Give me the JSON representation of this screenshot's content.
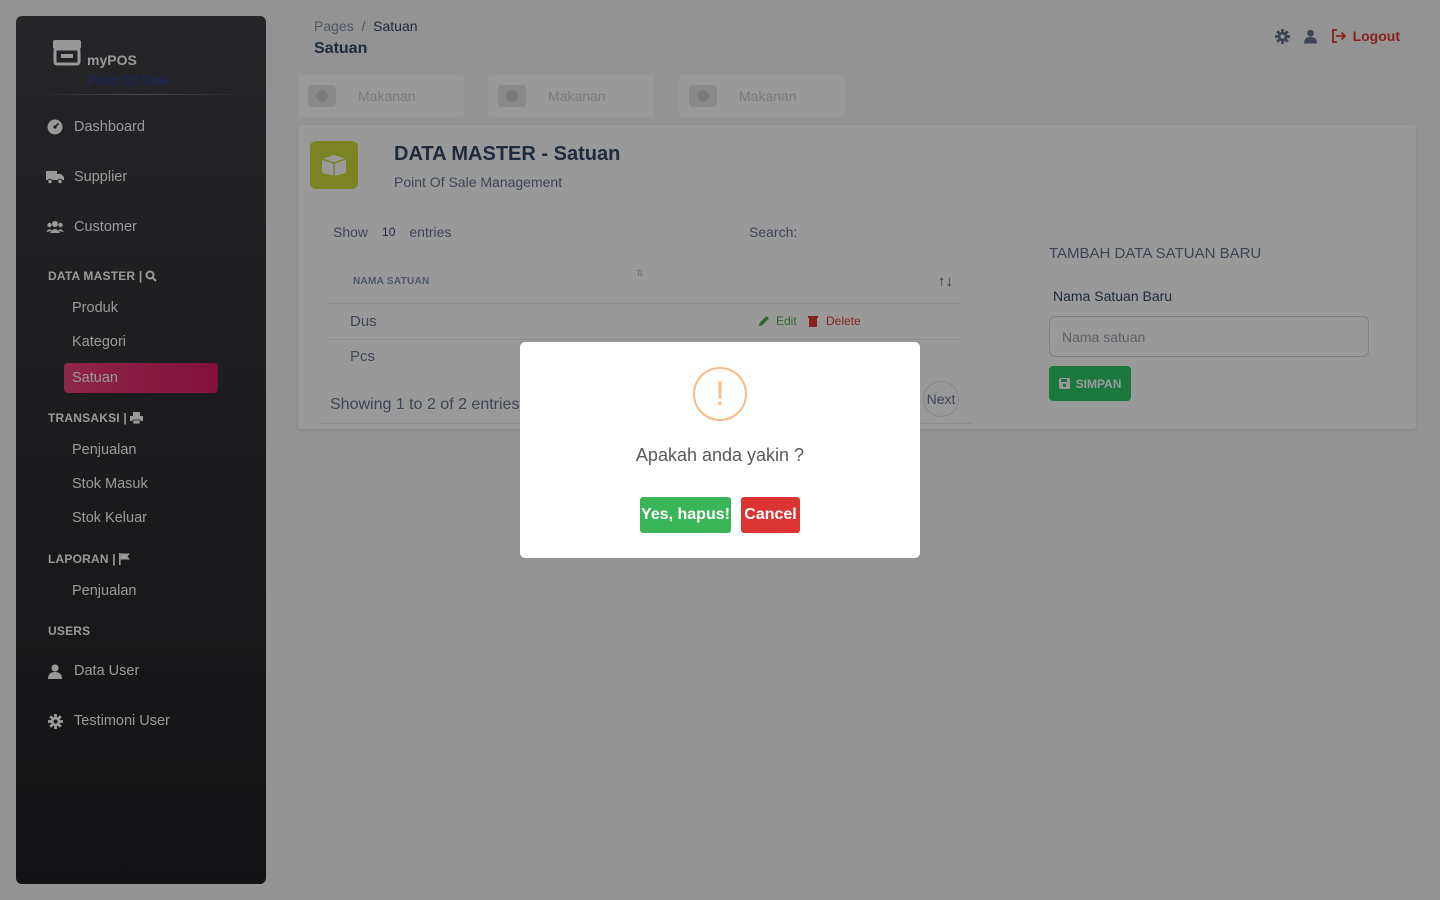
{
  "brand": {
    "name": "myPOS",
    "subtitle": "Point Of Sale"
  },
  "sidebar": {
    "top_items": [
      {
        "label": "Dashboard",
        "icon": "dashboard-icon"
      },
      {
        "label": "Supplier",
        "icon": "truck-icon"
      },
      {
        "label": "Customer",
        "icon": "users-icon"
      }
    ],
    "sections": {
      "data_master": "DATA MASTER |",
      "transaksi": "TRANSAKSI |",
      "laporan": "LAPORAN |",
      "users": "USERS"
    },
    "data_master_items": [
      "Produk",
      "Kategori",
      "Satuan"
    ],
    "transaksi_items": [
      "Penjualan",
      "Stok Masuk",
      "Stok Keluar"
    ],
    "laporan_items": [
      "Penjualan"
    ],
    "users_items": [
      {
        "label": "Data User",
        "icon": "user-icon"
      },
      {
        "label": "Testimoni User",
        "icon": "gear-icon"
      }
    ],
    "active": "Satuan"
  },
  "breadcrumb": {
    "root": "Pages",
    "separator": "/",
    "current": "Satuan"
  },
  "page_title": "Satuan",
  "topbar": {
    "logout": "Logout"
  },
  "stat_cards": [
    "Makanan",
    "Makanan",
    "Makanan"
  ],
  "card": {
    "title": "DATA MASTER - Satuan",
    "subtitle": "Point Of Sale Management",
    "show_label": "Show",
    "entries_value": "10",
    "entries_label": "entries",
    "search_label": "Search:",
    "table_header": "NAMA SATUAN",
    "rows": [
      "Dus",
      "Pcs"
    ],
    "edit_label": "Edit",
    "delete_label": "Delete",
    "showing": "Showing 1 to 2 of 2 entries",
    "next": "Next"
  },
  "form": {
    "title": "TAMBAH DATA SATUAN BARU",
    "label": "Nama Satuan Baru",
    "placeholder": "Nama satuan",
    "submit": "SIMPAN"
  },
  "modal": {
    "icon": "!",
    "message": "Apakah anda yakin ?",
    "confirm": "Yes, hapus!",
    "cancel": "Cancel"
  },
  "colors": {
    "active_nav": "#e91e63",
    "warning": "#f8bb86",
    "confirm": "#3bb55a",
    "cancel": "#dc3333",
    "card_icon": "#cddc39",
    "simpan": "#2ec866",
    "logout": "#e53935"
  }
}
